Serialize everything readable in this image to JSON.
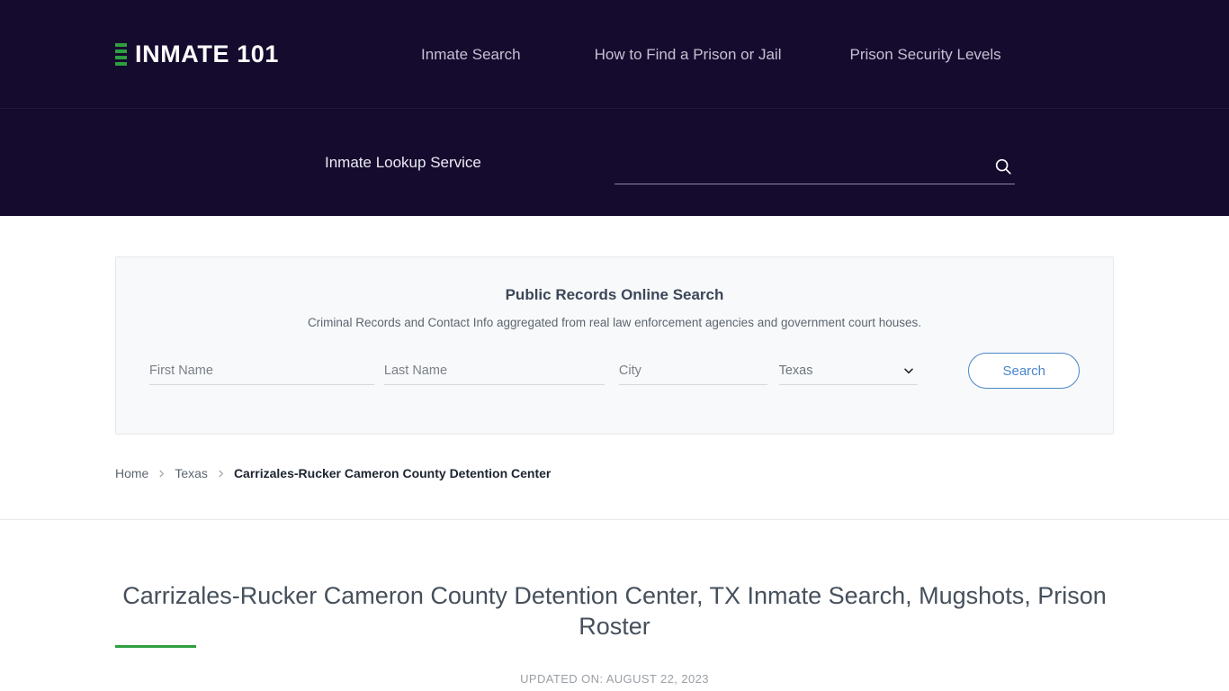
{
  "header": {
    "logo_text": "INMATE 101",
    "nav": [
      {
        "label": "Inmate Search"
      },
      {
        "label": "How to Find a Prison or Jail"
      },
      {
        "label": "Prison Security Levels"
      }
    ]
  },
  "lookup": {
    "label": "Inmate Lookup Service",
    "value": "",
    "placeholder": ""
  },
  "records": {
    "title": "Public Records Online Search",
    "subtitle": "Criminal Records and Contact Info aggregated from real law enforcement agencies and government court houses.",
    "first_name_placeholder": "First Name",
    "first_name_value": "",
    "last_name_placeholder": "Last Name",
    "last_name_value": "",
    "city_placeholder": "City",
    "city_value": "",
    "state_selected": "Texas",
    "state_options": [
      "Texas"
    ],
    "search_label": "Search"
  },
  "breadcrumb": {
    "home": "Home",
    "state": "Texas",
    "current": "Carrizales-Rucker Cameron County Detention Center"
  },
  "page": {
    "title": "Carrizales-Rucker Cameron County Detention Center, TX Inmate Search, Mugshots, Prison Roster",
    "updated": "UPDATED ON: AUGUST 22, 2023"
  },
  "colors": {
    "header_bg": "#150B2E",
    "accent_green": "#2E9E3F",
    "accent_blue": "#4A86C8",
    "title_text": "#46505C"
  }
}
